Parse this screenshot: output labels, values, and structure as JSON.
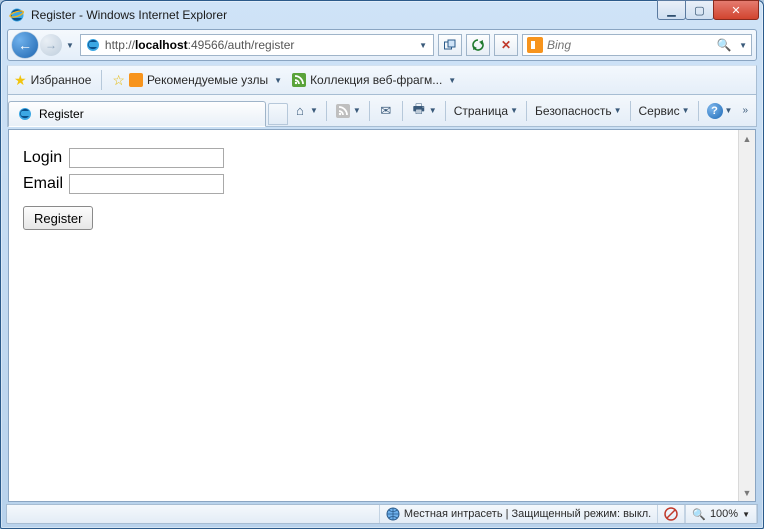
{
  "window": {
    "title": "Register - Windows Internet Explorer"
  },
  "nav": {
    "url_prefix": "http://",
    "url_host": "localhost",
    "url_rest": ":49566/auth/register",
    "search_placeholder": "Bing"
  },
  "favorites": {
    "label": "Избранное",
    "recommended": "Рекомендуемые узлы",
    "fragments": "Коллекция веб-фрагм..."
  },
  "tab": {
    "title": "Register"
  },
  "commandbar": {
    "page": "Страница",
    "security": "Безопасность",
    "tools": "Сервис"
  },
  "form": {
    "login_label": "Login",
    "email_label": "Email",
    "login_value": "",
    "email_value": "",
    "submit": "Register"
  },
  "status": {
    "zone": "Местная интрасеть | Защищенный режим: выкл.",
    "zoom": "100%"
  }
}
